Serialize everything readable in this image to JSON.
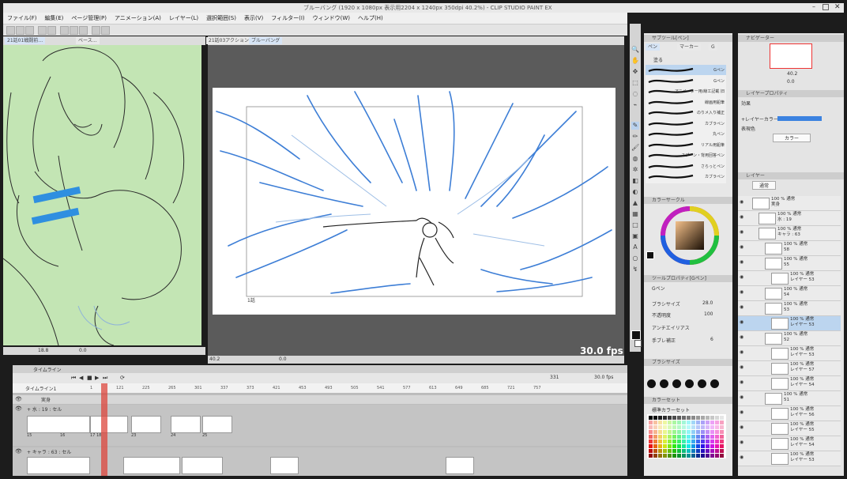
{
  "window": {
    "title": "ブルーバング (1920 x 1080px 表示用2204 x 1240px 350dpi 40.2%) - CLIP STUDIO PAINT EX"
  },
  "menu": [
    "ファイル(F)",
    "編集(E)",
    "ページ管理(P)",
    "アニメーション(A)",
    "レイヤー(L)",
    "選択範囲(S)",
    "表示(V)",
    "フィルター(I)",
    "ウィンドウ(W)",
    "ヘルプ(H)"
  ],
  "tabs_left": [
    "21話01戦闘前…",
    "ベース…"
  ],
  "tabs_main": [
    "21話03アクション",
    "ブルーバング"
  ],
  "sub_canvas": {
    "zoom": "18.8",
    "angle": "0.0"
  },
  "main": {
    "fps": "30.0 fps",
    "frame_label": "1話",
    "zoom": "40.2",
    "angle": "0.0"
  },
  "timeline": {
    "panel_title": "タイムライン",
    "track_name": "タイムライン1",
    "current_frame": "331",
    "frame_rate": "30.0 fps",
    "ruler": [
      "1",
      "121",
      "225",
      "265",
      "301",
      "337",
      "373",
      "421",
      "453",
      "493",
      "505",
      "541",
      "577",
      "613",
      "649",
      "685",
      "721",
      "757"
    ],
    "tracks": [
      {
        "name": "実身"
      },
      {
        "name": "+ 水 : 19 : セル",
        "labels": [
          "15",
          "16",
          "17 18",
          "23",
          "24",
          "25"
        ]
      },
      {
        "name": "+ キャラ : 63 : セル"
      }
    ]
  },
  "subtool": {
    "title": "サブツール[ペン]",
    "tabs": [
      "ペン",
      "マーカー",
      "G"
    ],
    "active_group": "塗る",
    "brushes": [
      "Gペン",
      "Gペン",
      "アニメーター用/線工記載 旧",
      "線画用鉛筆",
      "のりメ入り補正",
      "カブラペン",
      "丸ペン",
      "リアル用鉛筆",
      "スプーン・背用回答ペン",
      "さらっとペン",
      "カブラペン"
    ]
  },
  "color_wheel": {
    "title": "カラーサークル",
    "hue_color": "#b7712e"
  },
  "tool_property": {
    "title": "ツールプロパティ[Gペン]",
    "name": "Gペン",
    "brush_size_label": "ブラシサイズ",
    "brush_size": "28.0",
    "opacity_label": "不透明度",
    "opacity": "100",
    "antialias_label": "アンチエイリアス",
    "stabilization_label": "手ブレ補正",
    "stabilization": "6"
  },
  "brush_size_panel": {
    "title": "ブラシサイズ"
  },
  "color_set": {
    "title": "カラーセット",
    "name": "標準カラーセット"
  },
  "navigator": {
    "title": "ナビゲーター",
    "zoom": "40.2",
    "angle": "0.0"
  },
  "layer_property": {
    "title": "レイヤープロパティ",
    "effect_label": "効果",
    "layer_color_label": "+レイヤーカラー",
    "expression_label": "表現色",
    "expression_value": "カラー",
    "layer_color": "#3b82e0"
  },
  "layers": {
    "title": "レイヤー",
    "blend_mode": "通常",
    "items": [
      {
        "text": "100 % 通常\n実身",
        "indent": 0
      },
      {
        "text": "100 % 通常\n水 : 19",
        "indent": 1
      },
      {
        "text": "100 % 通常\nキャラ : 63",
        "indent": 1
      },
      {
        "text": "100 % 通常\n58",
        "indent": 2
      },
      {
        "text": "100 % 通常\n55",
        "indent": 2
      },
      {
        "text": "100 % 通常\nレイヤー 53",
        "indent": 3
      },
      {
        "text": "100 % 通常\n54",
        "indent": 2
      },
      {
        "text": "100 % 通常\n53",
        "indent": 2
      },
      {
        "text": "100 % 通常\nレイヤー 53",
        "indent": 3,
        "selected": true
      },
      {
        "text": "100 % 通常\n52",
        "indent": 2
      },
      {
        "text": "100 % 通常\nレイヤー 53",
        "indent": 3
      },
      {
        "text": "100 % 通常\nレイヤー 57",
        "indent": 3
      },
      {
        "text": "100 % 通常\nレイヤー 54",
        "indent": 3
      },
      {
        "text": "100 % 通常\n51",
        "indent": 2
      },
      {
        "text": "100 % 通常\nレイヤー 56",
        "indent": 3
      },
      {
        "text": "100 % 通常\nレイヤー 55",
        "indent": 3
      },
      {
        "text": "100 % 通常\nレイヤー 54",
        "indent": 3
      },
      {
        "text": "100 % 通常\nレイヤー 53",
        "indent": 3
      }
    ]
  },
  "colors": {
    "accent": "#3b82e0",
    "sub_canvas_bg": "#c3e5b4",
    "playhead": "#dc463c",
    "censor": "#2f8fe0"
  }
}
